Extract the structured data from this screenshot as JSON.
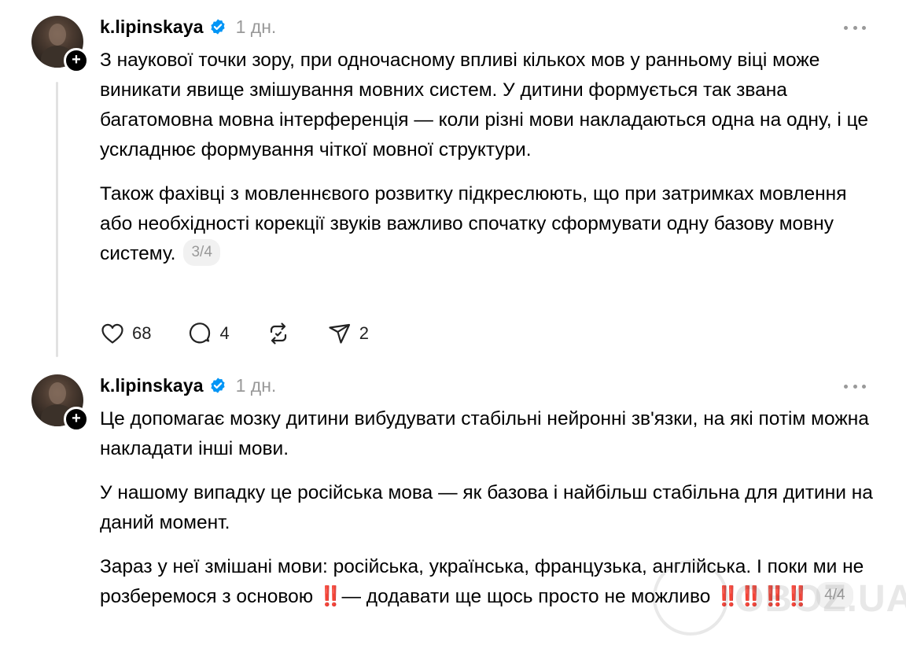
{
  "posts": [
    {
      "username": "k.lipinskaya",
      "time": "1 дн.",
      "paragraphs": [
        "З наукової точки зору, при одночасному впливі кількох мов у ранньому віці може виникати явище змішування мовних систем. У дитини формується так звана багатомовна мовна інтерференція — коли різні мови накладаються одна на одну, і це ускладнює формування чіткої мовної структури.",
        "Також фахівці з мовленнєвого розвитку підкреслюють, що при затримках мовлення або необхідності корекції звуків важливо спочатку сформувати одну базову мовну систему."
      ],
      "pager": "3/4",
      "likes": "68",
      "comments": "4",
      "shares": "2"
    },
    {
      "username": "k.lipinskaya",
      "time": "1 дн.",
      "paragraphs": [
        "Це допомагає мозку дитини вибудувати стабільні нейронні зв'язки, на які потім можна накладати інші мови.",
        "У нашому випадку це російська мова — як базова і найбільш стабільна для дитини на даний момент."
      ],
      "last_paragraph": {
        "part1": "Зараз у неї змішані мови: російська, українська, французька, англійська. І поки ми не розберемося з основою ",
        "bangs1": "‼️",
        "part2": "— додавати ще щось просто не можливо ",
        "bangs2": "‼️‼️‼️‼️"
      },
      "pager": "4/4"
    }
  ],
  "watermark": "OBOZ.UA",
  "colors": {
    "verified": "#0095f6",
    "muted": "#999999",
    "thread_line": "#e2e2e2",
    "emphasis": "#e8302a"
  },
  "icons": [
    "plus-icon",
    "verified-badge-icon",
    "more-options-icon",
    "heart-icon",
    "comment-icon",
    "repost-icon",
    "share-icon"
  ]
}
